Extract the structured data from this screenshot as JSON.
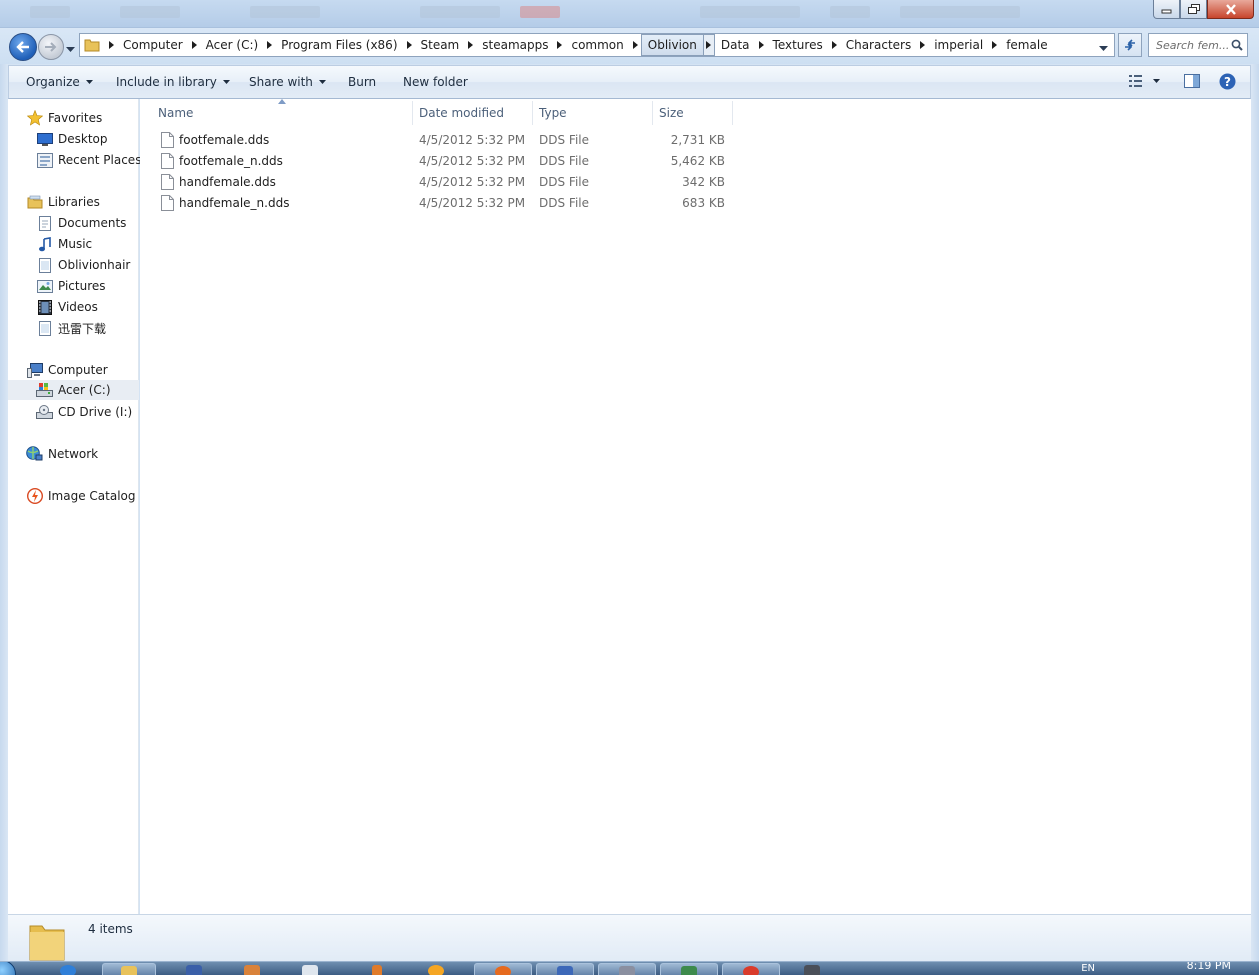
{
  "window": {
    "controls": {
      "minimize": "minimize",
      "maximize": "maximize",
      "close": "close"
    }
  },
  "address": {
    "crumbs": [
      "Computer",
      "Acer (C:)",
      "Program Files (x86)",
      "Steam",
      "steamapps",
      "common",
      "Oblivion",
      "Data",
      "Textures",
      "Characters",
      "imperial",
      "female"
    ],
    "active_crumb": "Oblivion",
    "search_placeholder": "Search fem..."
  },
  "toolbar": {
    "organize": "Organize",
    "include_in_library": "Include in library",
    "share_with": "Share with",
    "burn": "Burn",
    "new_folder": "New folder",
    "icons": [
      "view-options-icon",
      "preview-pane-icon",
      "help-icon"
    ]
  },
  "navpane": {
    "favorites": {
      "label": "Favorites",
      "items": [
        "Desktop",
        "Recent Places"
      ]
    },
    "libraries": {
      "label": "Libraries",
      "items": [
        "Documents",
        "Music",
        "Oblivionhair",
        "Pictures",
        "Videos",
        "迅雷下载"
      ]
    },
    "computer": {
      "label": "Computer",
      "items": [
        "Acer (C:)",
        "CD Drive (I:)"
      ],
      "selected": "Acer (C:)"
    },
    "network": {
      "label": "Network"
    },
    "image_catalog": {
      "label": "Image Catalog"
    }
  },
  "files": {
    "columns": [
      "Name",
      "Date modified",
      "Type",
      "Size"
    ],
    "sorted_by": "Name",
    "rows": [
      {
        "name": "footfemale.dds",
        "date": "4/5/2012 5:32 PM",
        "type": "DDS File",
        "size": "2,731 KB"
      },
      {
        "name": "footfemale_n.dds",
        "date": "4/5/2012 5:32 PM",
        "type": "DDS File",
        "size": "5,462 KB"
      },
      {
        "name": "handfemale.dds",
        "date": "4/5/2012 5:32 PM",
        "type": "DDS File",
        "size": "342 KB"
      },
      {
        "name": "handfemale_n.dds",
        "date": "4/5/2012 5:32 PM",
        "type": "DDS File",
        "size": "683 KB"
      }
    ]
  },
  "details": {
    "count": "4 items"
  },
  "taskbar": {
    "lang": "EN",
    "clock": "8:19 PM"
  },
  "colors": {
    "accent": "#1f5fb8",
    "close": "#c7452c",
    "window_frame": "#c6daf0"
  }
}
